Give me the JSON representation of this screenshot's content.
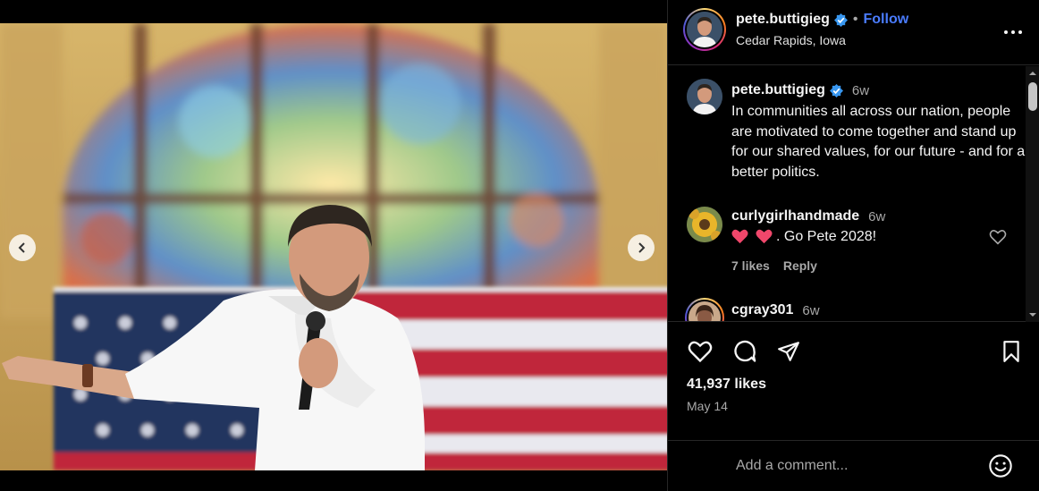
{
  "post": {
    "username": "pete.buttigieg",
    "location": "Cedar Rapids, Iowa",
    "follow_label": "Follow",
    "separator": "•",
    "caption": {
      "username": "pete.buttigieg",
      "time": "6w",
      "text": "In communities all across our nation, people are motivated to come together and stand up for our shared values, for our future - and for a better politics."
    },
    "comments": [
      {
        "username": "curlygirlhandmade",
        "time": "6w",
        "emojis": [
          "heart",
          "heart"
        ],
        "text": ". Go Pete 2028!",
        "likes": "7 likes",
        "reply_label": "Reply"
      },
      {
        "username": "cgray301",
        "time": "6w"
      }
    ],
    "likes": "41,937 likes",
    "date": "May 14",
    "comment_placeholder": "Add a comment..."
  },
  "icons": {
    "verified": "verified-badge-icon",
    "more": "more-options-icon",
    "like": "heart-outline-icon",
    "comment": "comment-bubble-icon",
    "share": "paper-plane-icon",
    "save": "bookmark-icon",
    "emoji": "emoji-smile-icon",
    "prev": "chevron-left-icon",
    "next": "chevron-right-icon"
  },
  "colors": {
    "background": "#000000",
    "accent": "#4a7cff",
    "verified": "#3897f0",
    "muted_text": "#a8a8a8",
    "heart_emoji": "#f0476b"
  }
}
